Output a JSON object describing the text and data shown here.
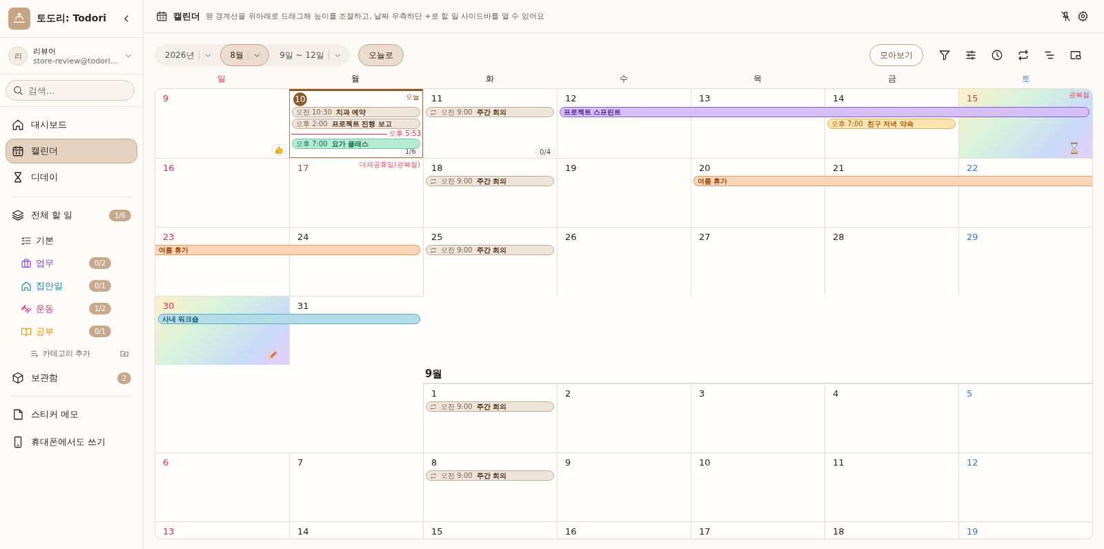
{
  "sidebar": {
    "app_name": "토도리: Todori",
    "user": {
      "initial": "리",
      "name": "리뷰어",
      "email": "store-review@todori..."
    },
    "search": {
      "placeholder": "검색..."
    },
    "nav": [
      {
        "label": "대시보드",
        "selected": false
      },
      {
        "label": "캘린더",
        "selected": true
      },
      {
        "label": "디데이",
        "selected": false
      }
    ],
    "all_tasks": {
      "label": "전체 할 일",
      "count": "1/6"
    },
    "categories": [
      {
        "label": "기본",
        "color": "#333333"
      },
      {
        "label": "업무",
        "color": "#7c3aed",
        "count": "0/2"
      },
      {
        "label": "집안일",
        "color": "#0e8aa0",
        "count": "0/1"
      },
      {
        "label": "운동",
        "color": "#db2777",
        "count": "1/2"
      },
      {
        "label": "공부",
        "color": "#e59a0a",
        "count": "0/1"
      }
    ],
    "add_category": "카테고리 추가",
    "archive": {
      "label": "보관함",
      "count": "2"
    },
    "extras": [
      {
        "label": "스티커 메모"
      },
      {
        "label": "휴대폰에서도 쓰기"
      }
    ]
  },
  "header": {
    "title": "캘린더",
    "hint": "행 경계선을 위아래로 드래그해 높이를 조절하고, 날짜 우측하단 +로 할 일 사이드바를 열 수 있어요"
  },
  "toolbar": {
    "segments": [
      {
        "label": "2026년",
        "selected": false
      },
      {
        "label": "8월",
        "selected": true
      },
      {
        "label": "9일 ~ 12일",
        "selected": false
      }
    ],
    "today_button": "오늘로",
    "gallery_button": "모아보기"
  },
  "weekdays": [
    {
      "label": "일",
      "kind": "sunday"
    },
    {
      "label": "월",
      "kind": "weekday"
    },
    {
      "label": "화",
      "kind": "weekday"
    },
    {
      "label": "수",
      "kind": "weekday"
    },
    {
      "label": "목",
      "kind": "weekday"
    },
    {
      "label": "금",
      "kind": "weekday"
    },
    {
      "label": "토",
      "kind": "saturday"
    }
  ],
  "weeks": [
    {
      "kind": "full",
      "days": [
        {
          "date": "9",
          "kind": "sunday",
          "sticker": {
            "kind": "thumbs_up"
          }
        },
        {
          "date": "10",
          "kind": "weekday",
          "today": true,
          "today_label": "오늘",
          "count": "1/6",
          "lanes": [
            {
              "kind": "timed",
              "time": "오전 10:30",
              "title": "치과 예약",
              "color": "#efe4da",
              "repeat": false
            },
            {
              "kind": "timed",
              "time": "오후 2:00",
              "title": "프로젝트 진행 보고",
              "color": "#efe4da",
              "repeat": false
            },
            {
              "kind": "now",
              "label": "오후 5:53"
            },
            {
              "kind": "timed",
              "time": "오후 7:00",
              "title": "요가 클래스",
              "color": "#b5ead5",
              "repeat": false
            }
          ]
        },
        {
          "date": "11",
          "kind": "weekday",
          "count": "0/4",
          "lanes": [
            {
              "kind": "timed",
              "time": "오전 9:00",
              "title": "주간 회의",
              "color": "#efe4da",
              "repeat": true
            }
          ]
        },
        {
          "date": "12",
          "kind": "weekday",
          "lanes": [
            {
              "kind": "bar",
              "title": "프로젝트 스프린트",
              "color": "#d5bff5",
              "from_before": false,
              "to_after": false
            }
          ]
        },
        {
          "date": "13",
          "kind": "weekday",
          "lanes": [
            {
              "kind": "cont"
            }
          ]
        },
        {
          "date": "14",
          "kind": "weekday",
          "lanes": [
            {
              "kind": "cont"
            },
            {
              "kind": "timed",
              "time": "오후 7:00",
              "title": "친구 저녁 약속",
              "color": "#fde3b0",
              "repeat": false
            }
          ]
        },
        {
          "date": "15",
          "kind": "holiday",
          "holiday": "광복절",
          "highlight": true,
          "sticker": {
            "kind": "hourglass"
          },
          "lanes": [
            {
              "kind": "cont"
            }
          ]
        }
      ]
    },
    {
      "kind": "full",
      "days": [
        {
          "date": "16",
          "kind": "sunday"
        },
        {
          "date": "17",
          "kind": "holiday",
          "holiday": "대체공휴일(광복절)"
        },
        {
          "date": "18",
          "kind": "weekday",
          "lanes": [
            {
              "kind": "timed",
              "time": "오전 9:00",
              "title": "주간 회의",
              "color": "#efe4da",
              "repeat": true
            }
          ]
        },
        {
          "date": "19",
          "kind": "weekday"
        },
        {
          "date": "20",
          "kind": "weekday",
          "lanes": [
            {
              "kind": "bar",
              "title": "여름 휴가",
              "color": "#fcd6b8",
              "from_before": false,
              "to_after": true
            }
          ]
        },
        {
          "date": "21",
          "kind": "weekday",
          "lanes": [
            {
              "kind": "cont"
            }
          ]
        },
        {
          "date": "22",
          "kind": "saturday",
          "lanes": [
            {
              "kind": "cont"
            }
          ]
        }
      ]
    },
    {
      "kind": "full",
      "days": [
        {
          "date": "23",
          "kind": "sunday",
          "lanes": [
            {
              "kind": "bar",
              "title": "여름 휴가",
              "color": "#fcd6b8",
              "from_before": true,
              "to_after": false
            }
          ]
        },
        {
          "date": "24",
          "kind": "weekday",
          "lanes": [
            {
              "kind": "cont"
            }
          ]
        },
        {
          "date": "25",
          "kind": "weekday",
          "lanes": [
            {
              "kind": "timed",
              "time": "오전 9:00",
              "title": "주간 회의",
              "color": "#efe4da",
              "repeat": true
            }
          ]
        },
        {
          "date": "26",
          "kind": "weekday"
        },
        {
          "date": "27",
          "kind": "weekday"
        },
        {
          "date": "28",
          "kind": "weekday"
        },
        {
          "date": "29",
          "kind": "saturday"
        }
      ]
    },
    {
      "kind": "month_end",
      "next_month": "9월",
      "days": [
        {
          "date": "30",
          "kind": "sunday",
          "highlight": true,
          "sticker": {
            "kind": "pencil"
          },
          "lanes": [
            {
              "kind": "bar",
              "title": "사내 워크숍",
              "color": "#b5dde9",
              "from_before": false,
              "to_after": false
            }
          ]
        },
        {
          "date": "31",
          "kind": "weekday",
          "lanes": [
            {
              "kind": "cont"
            }
          ]
        }
      ]
    },
    {
      "kind": "month_start",
      "days": [
        {
          "date": "1",
          "kind": "weekday",
          "lanes": [
            {
              "kind": "timed",
              "time": "오전 9:00",
              "title": "주간 회의",
              "color": "#efe4da",
              "repeat": true
            }
          ]
        },
        {
          "date": "2",
          "kind": "weekday"
        },
        {
          "date": "3",
          "kind": "weekday"
        },
        {
          "date": "4",
          "kind": "weekday"
        },
        {
          "date": "5",
          "kind": "saturday"
        }
      ]
    },
    {
      "kind": "full",
      "days": [
        {
          "date": "6",
          "kind": "sunday"
        },
        {
          "date": "7",
          "kind": "weekday"
        },
        {
          "date": "8",
          "kind": "weekday",
          "lanes": [
            {
              "kind": "timed",
              "time": "오전 9:00",
              "title": "주간 회의",
              "color": "#efe4da",
              "repeat": true
            }
          ]
        },
        {
          "date": "9",
          "kind": "weekday"
        },
        {
          "date": "10",
          "kind": "weekday"
        },
        {
          "date": "11",
          "kind": "weekday"
        },
        {
          "date": "12",
          "kind": "saturday"
        }
      ]
    },
    {
      "kind": "full",
      "days": [
        {
          "date": "13",
          "kind": "sunday"
        },
        {
          "date": "14",
          "kind": "weekday"
        },
        {
          "date": "15",
          "kind": "weekday"
        },
        {
          "date": "16",
          "kind": "weekday"
        },
        {
          "date": "17",
          "kind": "weekday"
        },
        {
          "date": "18",
          "kind": "weekday"
        },
        {
          "date": "19",
          "kind": "saturday"
        }
      ]
    }
  ]
}
